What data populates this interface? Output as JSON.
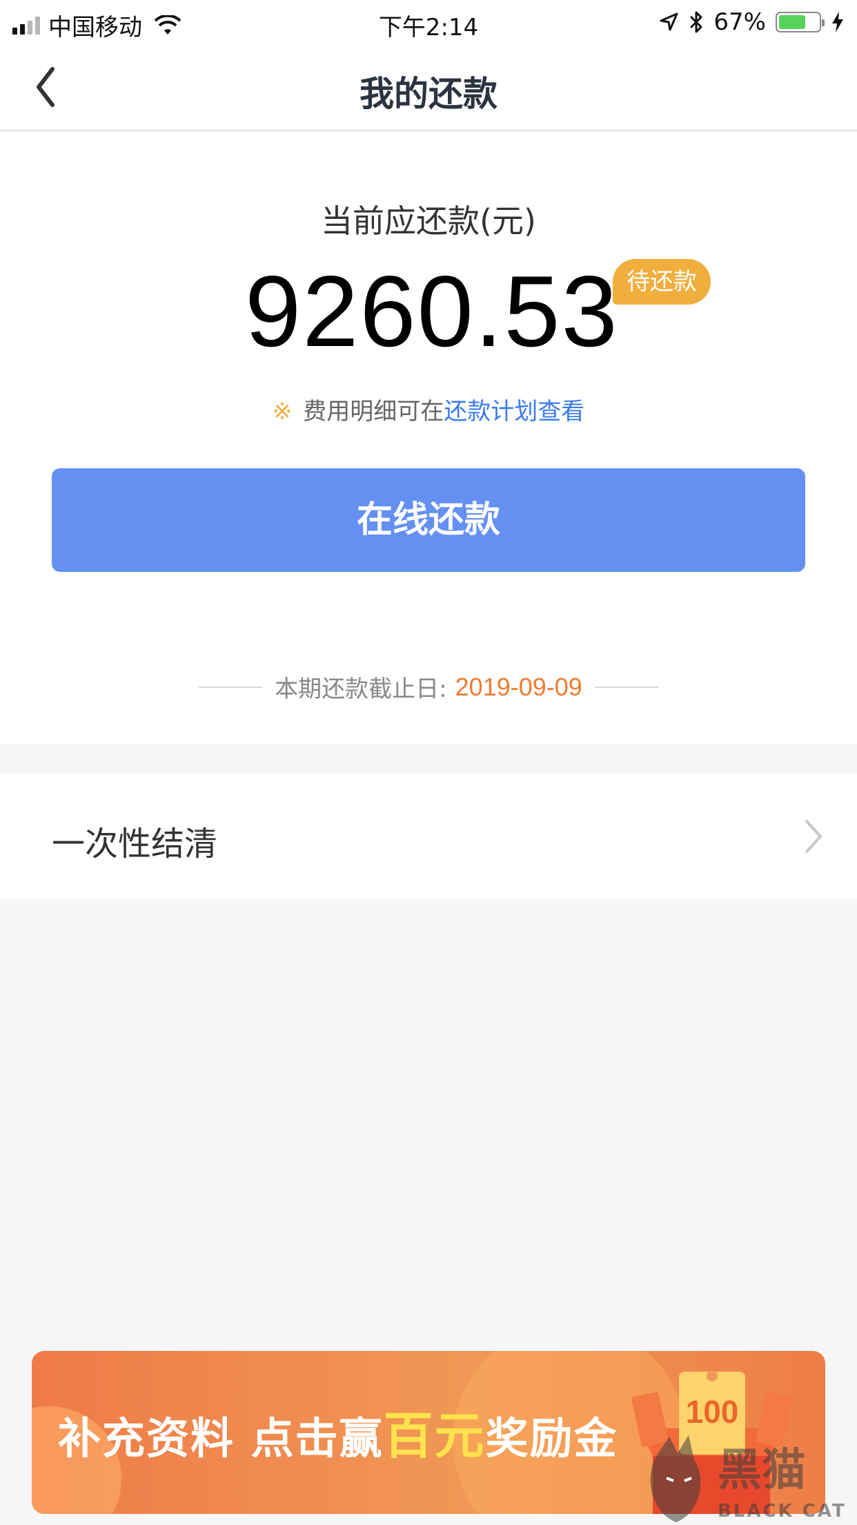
{
  "status_bar": {
    "carrier": "中国移动",
    "time": "下午2:14",
    "battery_percent": "67%",
    "battery_level": 0.67
  },
  "nav": {
    "title": "我的还款"
  },
  "summary": {
    "amount_label": "当前应还款(元)",
    "amount": "9260.53",
    "status_badge": "待还款",
    "note_mark": "※",
    "note_text": "费用明细可在",
    "note_link": "还款计划查看",
    "pay_button": "在线还款",
    "deadline_label": "本期还款截止日:",
    "deadline_date": "2019-09-09"
  },
  "settle": {
    "label": "一次性结清"
  },
  "banner": {
    "text_part1": "补充资料 点击赢",
    "text_highlight": "百元",
    "text_part2": "奖励金",
    "gift_amount": "100"
  },
  "watermark": {
    "text": "黑猫",
    "subtext": "BLACK CAT"
  },
  "colors": {
    "primary_button": "#6490f2",
    "badge": "#f1ae3d",
    "link": "#3a7bf0",
    "deadline_date": "#ef7b2e",
    "banner": "#ef7b48"
  }
}
